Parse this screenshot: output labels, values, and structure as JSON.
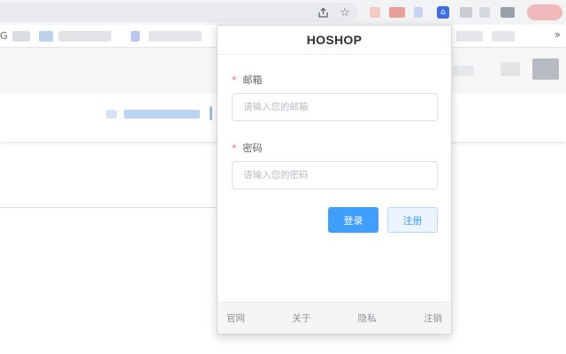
{
  "popup": {
    "title": "HOSHOP",
    "email": {
      "label": "邮箱",
      "required_mark": "*",
      "placeholder": "请输入您的邮箱",
      "value": ""
    },
    "password": {
      "label": "密码",
      "required_mark": "*",
      "placeholder": "请输入您的密码",
      "value": ""
    },
    "buttons": {
      "login": "登录",
      "register": "注册"
    },
    "footer_links": [
      "官网",
      "关于",
      "隐私",
      "注销"
    ]
  },
  "browser": {
    "bookmarks_leading_text": "G",
    "bookmarks_more": "»",
    "icons": [
      "share-icon",
      "bookmark-star-icon",
      "hoshop-extension-icon"
    ]
  },
  "colors": {
    "primary": "#409eff",
    "primary_light": "#ecf5ff",
    "required": "#f56c6c",
    "footer_bg": "#f5f5f6"
  }
}
